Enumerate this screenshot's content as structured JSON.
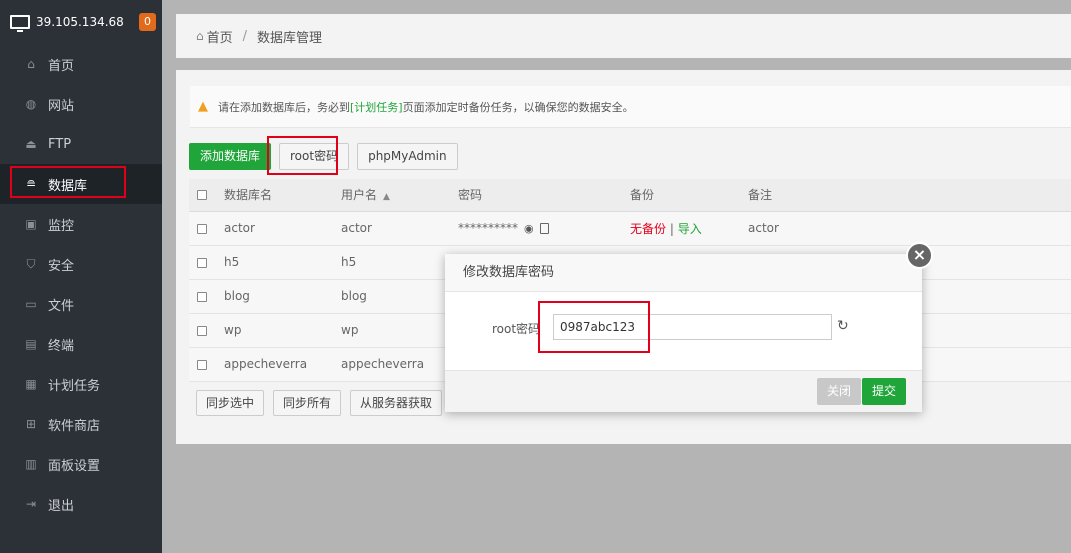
{
  "header": {
    "ip": "39.105.134.68",
    "badge": "0"
  },
  "sidebar": {
    "items": [
      {
        "label": "首页",
        "icon": "home-icon",
        "glyph": "⌂"
      },
      {
        "label": "网站",
        "icon": "globe-icon",
        "glyph": "◍"
      },
      {
        "label": "FTP",
        "icon": "ftp-icon",
        "glyph": "⏏"
      },
      {
        "label": "数据库",
        "icon": "database-icon",
        "glyph": "≘"
      },
      {
        "label": "监控",
        "icon": "monitor-icon",
        "glyph": "▣"
      },
      {
        "label": "安全",
        "icon": "shield-icon",
        "glyph": "⛉"
      },
      {
        "label": "文件",
        "icon": "folder-icon",
        "glyph": "▭"
      },
      {
        "label": "终端",
        "icon": "terminal-icon",
        "glyph": "▤"
      },
      {
        "label": "计划任务",
        "icon": "calendar-icon",
        "glyph": "▦"
      },
      {
        "label": "软件商店",
        "icon": "apps-icon",
        "glyph": "⊞"
      },
      {
        "label": "面板设置",
        "icon": "settings-icon",
        "glyph": "▥"
      },
      {
        "label": "退出",
        "icon": "logout-icon",
        "glyph": "⇥"
      }
    ]
  },
  "breadcrumb": {
    "home": "首页",
    "sep": "/",
    "current": "数据库管理"
  },
  "notice": {
    "pre": "请在添加数据库后，务必到",
    "link": "[计划任务]",
    "post": "页面添加定时备份任务，以确保您的数据安全。"
  },
  "toolbar": {
    "add": "添加数据库",
    "root": "root密码",
    "pma": "phpMyAdmin"
  },
  "table": {
    "headers": [
      "数据库名",
      "用户名",
      "密码",
      "备份",
      "备注"
    ],
    "rows": [
      {
        "name": "actor",
        "user": "actor",
        "password": "**********",
        "backup_none": "无备份",
        "backup_sep": " | ",
        "import": "导入",
        "note": "actor"
      },
      {
        "name": "h5",
        "user": "h5"
      },
      {
        "name": "blog",
        "user": "blog"
      },
      {
        "name": "wp",
        "user": "wp"
      },
      {
        "name": "appecheverra",
        "user": "appecheverra"
      }
    ]
  },
  "bottom": {
    "sync_sel": "同步选中",
    "sync_all": "同步所有",
    "from_server": "从服务器获取"
  },
  "modal": {
    "title": "修改数据库密码",
    "label": "root密码",
    "value": "0987abc123",
    "close": "关闭",
    "submit": "提交"
  }
}
